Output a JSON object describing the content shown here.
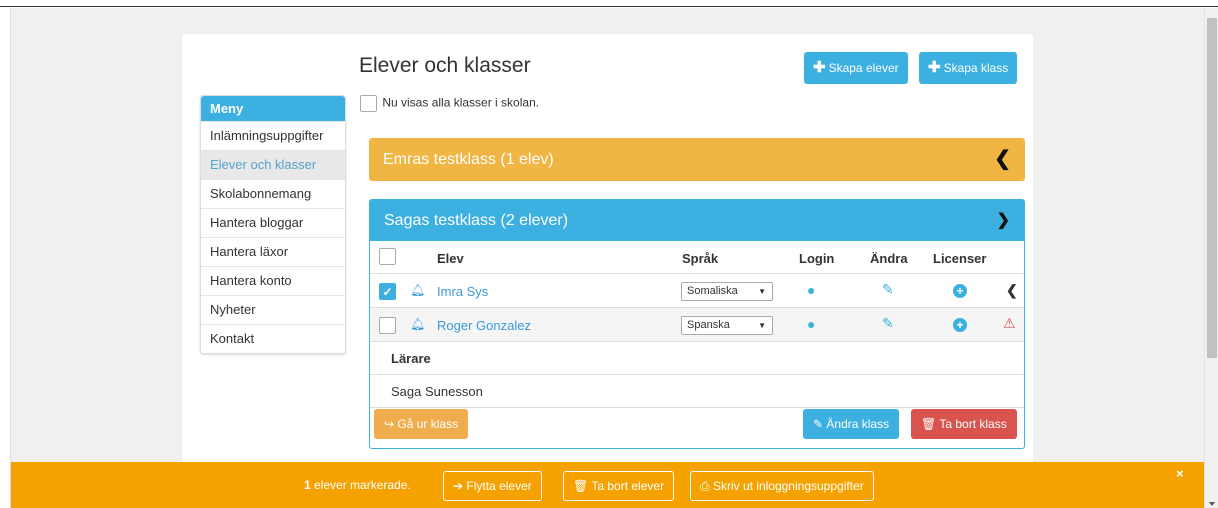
{
  "page": {
    "title": "Elever och klasser",
    "note": "Nu visas alla klasser i skolan.",
    "create_students_label": "Skapa elever",
    "create_class_label": "Skapa klass"
  },
  "menu": {
    "header": "Meny",
    "items": [
      {
        "label": "Inlämningsuppgifter"
      },
      {
        "label": "Elever och klasser",
        "active": true
      },
      {
        "label": "Skolabonnemang"
      },
      {
        "label": "Hantera bloggar"
      },
      {
        "label": "Hantera läxor"
      },
      {
        "label": "Hantera konto"
      },
      {
        "label": "Nyheter"
      },
      {
        "label": "Kontakt"
      }
    ]
  },
  "classes": [
    {
      "title": "Emras testklass (1 elev)",
      "expanded": false,
      "color": "#f0b542"
    },
    {
      "title": "Sagas testklass (2 elever)",
      "expanded": true,
      "color": "#3cb0e0",
      "columns": {
        "student": "Elev",
        "language": "Språk",
        "login": "Login",
        "edit": "Ändra",
        "licenses": "Licenser"
      },
      "students": [
        {
          "name": "Imra Sys",
          "language": "Somaliska",
          "checked": true,
          "status": "chevron-left"
        },
        {
          "name": "Roger Gonzalez",
          "language": "Spanska",
          "checked": false,
          "status": "warning"
        }
      ],
      "teachers_label": "Lärare",
      "teachers": [
        "Saga Sunesson"
      ],
      "leave_class_label": "Gå ur klass",
      "edit_class_label": "Ändra klass",
      "delete_class_label": "Ta bort klass"
    }
  ],
  "bottom_bar": {
    "count": "1",
    "count_suffix": "elever markerade.",
    "move_label": "Flytta elever",
    "delete_label": "Ta bort elever",
    "print_label": "Skriv ut inloggningsuppgifter",
    "close": "×"
  },
  "colors": {
    "accent": "#3cb0e0",
    "warning": "#f0b542",
    "danger": "#d9534f",
    "bar": "#f5a200"
  }
}
